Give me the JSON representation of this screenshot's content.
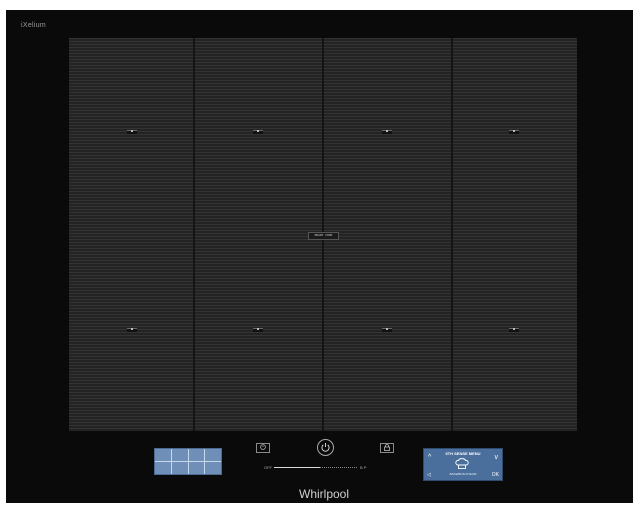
{
  "hob": {
    "series_name": "iXelium",
    "brand": "Whirlpool",
    "center_logo_text": "SMART COOK",
    "zones": [
      {
        "label": "zone-1"
      },
      {
        "label": "zone-2"
      },
      {
        "label": "zone-3"
      },
      {
        "label": "zone-4"
      },
      {
        "label": "zone-5"
      },
      {
        "label": "zone-6"
      },
      {
        "label": "zone-7"
      },
      {
        "label": "zone-8"
      }
    ]
  },
  "controls": {
    "timer_icon": "timer-icon",
    "power_icon": "power-icon",
    "lock_icon": "lock-icon",
    "power_slider": {
      "min_label": "OFF",
      "max_label": "B P",
      "level": 0.55
    },
    "display": {
      "title": "6TH SENSE MENU",
      "subtitle": "BAKE/BOIL/STEAM",
      "up_label": "^",
      "down_label": "v",
      "back_label": "◁",
      "ok_label": "OK"
    }
  },
  "colors": {
    "hob_surface": "#0a0a0a",
    "zone_map": "#6f8fb8",
    "display": "#4a6f9c"
  }
}
